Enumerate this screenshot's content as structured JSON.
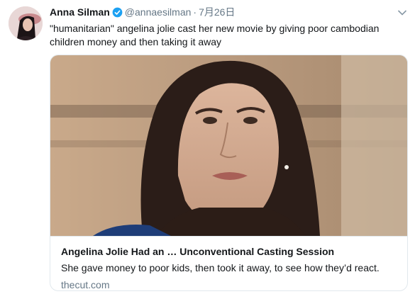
{
  "tweet": {
    "author_name": "Anna Silman",
    "handle": "@annaesilman",
    "separator": "·",
    "timestamp": "7月26日",
    "text": "\"humanitarian\" angelina jolie cast her new movie by giving poor cambodian children money and then taking it away"
  },
  "card": {
    "title": "Angelina Jolie Had an … Unconventional Casting Session",
    "description": "She gave money to poor kids, then took it away, to see how they’d react.",
    "domain": "thecut.com"
  },
  "icons": {
    "verified": "verified-badge-icon",
    "more": "chevron-down-icon"
  },
  "colors": {
    "verified_blue": "#1da1f2",
    "secondary_text": "#657786",
    "border": "#e1e8ed"
  }
}
